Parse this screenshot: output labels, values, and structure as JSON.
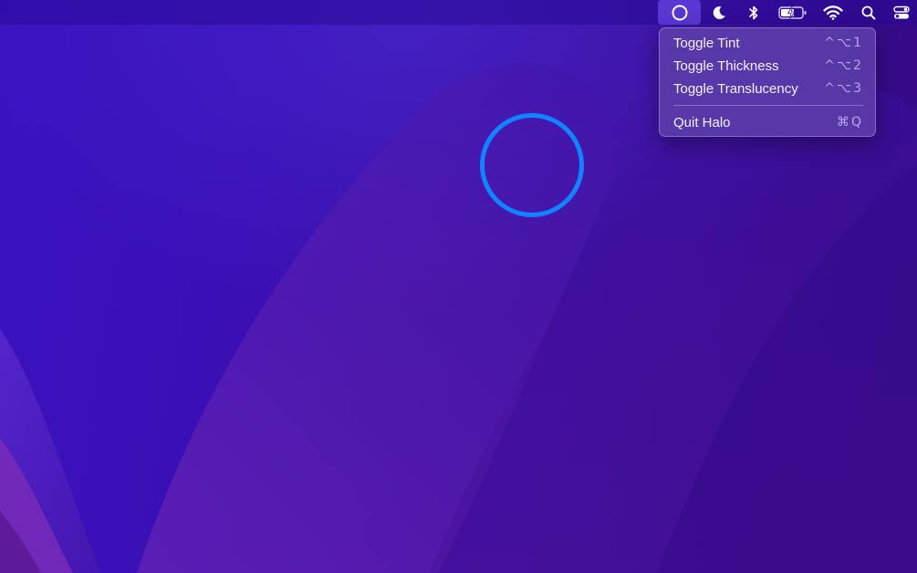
{
  "menubar": {
    "status_items": [
      {
        "name": "halo",
        "icon": "circle-icon",
        "active": true
      },
      {
        "name": "focus",
        "icon": "moon-icon"
      },
      {
        "name": "bluetooth",
        "icon": "bluetooth-icon"
      },
      {
        "name": "battery",
        "icon": "battery-charging-icon"
      },
      {
        "name": "wifi",
        "icon": "wifi-icon"
      },
      {
        "name": "spotlight",
        "icon": "search-icon"
      },
      {
        "name": "control-center",
        "icon": "control-center-icon"
      }
    ]
  },
  "halo_menu": {
    "items": [
      {
        "label": "Toggle Tint",
        "shortcut": "^⌥1"
      },
      {
        "label": "Toggle Thickness",
        "shortcut": "^⌥2"
      },
      {
        "label": "Toggle Translucency",
        "shortcut": "^⌥3"
      },
      {
        "label": "Quit Halo",
        "shortcut": "⌘Q"
      }
    ]
  },
  "halo_overlay": {
    "color": "#1183ff"
  },
  "colors": {
    "wallpaper_base": "#3a10b4",
    "menu_background": "#5c3eaa",
    "menu_text": "#f5f2ff",
    "menu_shortcut": "#b8a6e6"
  }
}
